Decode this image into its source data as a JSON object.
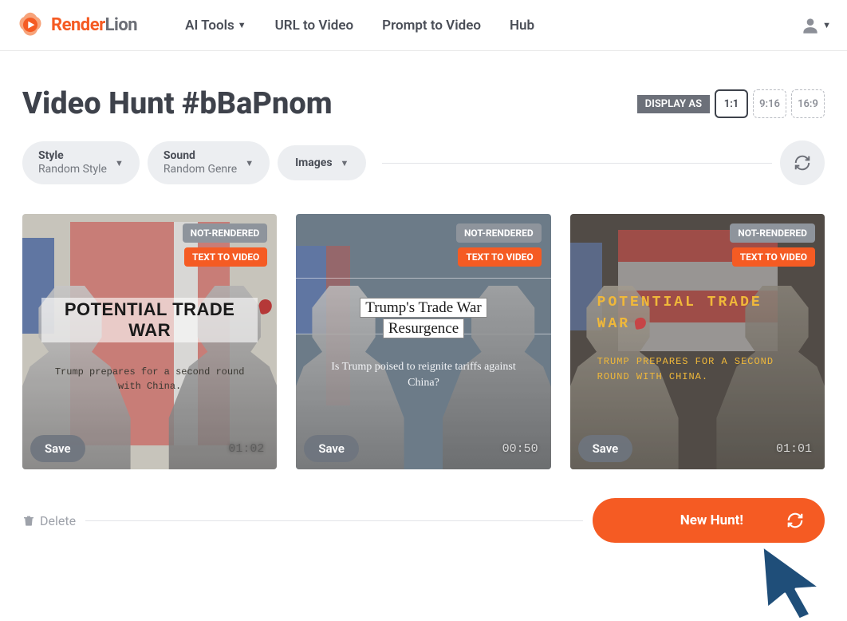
{
  "brand": {
    "name1": "Render",
    "name2": "Lion"
  },
  "nav": {
    "ai_tools": "AI Tools",
    "url_to_video": "URL to Video",
    "prompt_to_video": "Prompt to Video",
    "hub": "Hub"
  },
  "page_title": "Video Hunt #bBaPnom",
  "display_as": {
    "label": "DISPLAY AS",
    "options": [
      "1:1",
      "9:16",
      "16:9"
    ],
    "active": "1:1"
  },
  "filters": {
    "style": {
      "label": "Style",
      "value": "Random Style"
    },
    "sound": {
      "label": "Sound",
      "value": "Random Genre"
    },
    "images": {
      "label": "Images"
    }
  },
  "badges": {
    "not_rendered": "NOT-RENDERED",
    "text_to_video": "TEXT TO VIDEO"
  },
  "cards": [
    {
      "title": "POTENTIAL TRADE WAR",
      "subtitle": "Trump prepares for a second round with China.",
      "save": "Save",
      "duration": "01:02"
    },
    {
      "title_line1": "Trump's Trade War",
      "title_line2": "Resurgence",
      "subtitle": "Is Trump poised to reignite tariffs against China?",
      "save": "Save",
      "duration": "00:50"
    },
    {
      "title": "POTENTIAL TRADE WAR",
      "subtitle": "TRUMP PREPARES FOR A SECOND ROUND WITH CHINA.",
      "save": "Save",
      "duration": "01:01"
    }
  ],
  "bottom": {
    "delete": "Delete",
    "new_hunt": "New Hunt!"
  }
}
